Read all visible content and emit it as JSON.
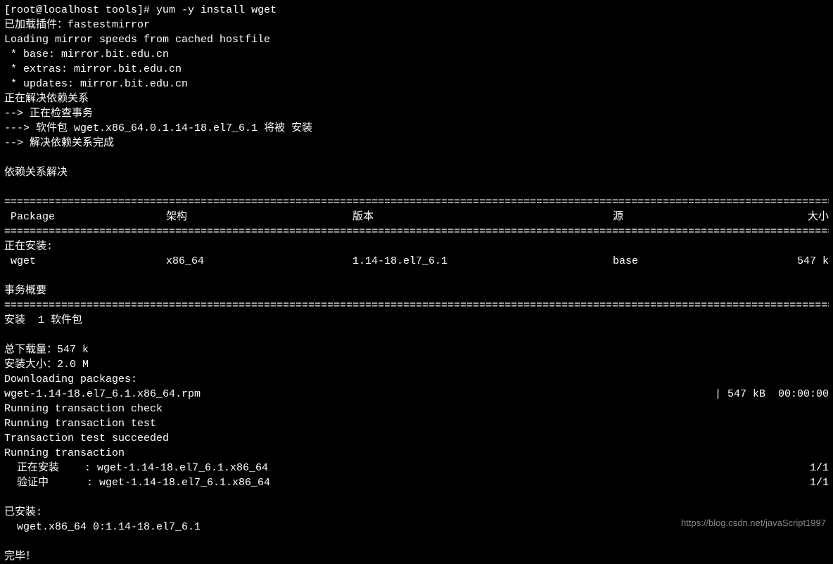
{
  "prompt": "[root@localhost tools]# ",
  "command": "yum -y install wget",
  "loaded_plugins_label": "已加载插件：",
  "loaded_plugins_value": "fastestmirror",
  "loading_mirror": "Loading mirror speeds from cached hostfile",
  "mirrors": {
    "base": " * base: mirror.bit.edu.cn",
    "extras": " * extras: mirror.bit.edu.cn",
    "updates": " * updates: mirror.bit.edu.cn"
  },
  "resolving_deps": "正在解决依赖关系",
  "checking_trans": "--> 正在检查事务",
  "pkg_line_prefix": "---> 软件包 ",
  "pkg_line_name": "wget.x86_64.0.1.14-18.el7_6.1",
  "pkg_line_suffix": " 将被 安装",
  "finished_deps": "--> 解决依赖关系完成",
  "deps_resolved": "依赖关系解决",
  "headers": {
    "package": " Package",
    "arch": "架构",
    "version": "版本",
    "repo": "源",
    "size": "大小"
  },
  "installing_label": "正在安装:",
  "row": {
    "package": " wget",
    "arch": "x86_64",
    "version": "1.14-18.el7_6.1",
    "repo": "base",
    "size": "547 k"
  },
  "transaction_summary": "事务概要",
  "install_count": "安装  1 软件包",
  "total_download": "总下载量：547 k",
  "installed_size": "安装大小：2.0 M",
  "downloading_packages": "Downloading packages:",
  "rpm_file": "wget-1.14-18.el7_6.1.x86_64.rpm",
  "rpm_stats": "| 547 kB  00:00:00",
  "running_check": "Running transaction check",
  "running_test": "Running transaction test",
  "test_succeeded": "Transaction test succeeded",
  "running_transaction": "Running transaction",
  "install_step": {
    "label": "  正在安装    : wget-1.14-18.el7_6.1.x86_64",
    "count": "1/1"
  },
  "verify_step": {
    "label": "  验证中      : wget-1.14-18.el7_6.1.x86_64",
    "count": "1/1"
  },
  "installed_label": "已安装:",
  "installed_pkg": "  wget.x86_64 0:1.14-18.el7_6.1",
  "complete": "完毕！",
  "watermark": "https://blog.csdn.net/javaScript1997",
  "divider": "===================================================================================================================================="
}
